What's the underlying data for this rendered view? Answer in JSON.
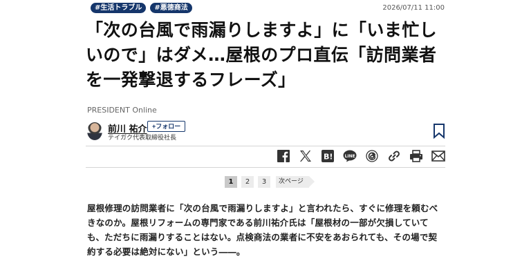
{
  "tags": [
    "#生活トラブル",
    "#悪徳商法"
  ],
  "date": "2026/07/11 11:00",
  "headline": "「次の台風で雨漏りしますよ」に「いま忙しいので」はダメ…屋根のプロ直伝「訪問業者を一発撃退するフレーズ」",
  "source": "PRESIDENT Online",
  "author": {
    "name": "前川 祐介",
    "follow_label": "+フォロー",
    "title": "テイガク代表取締役社長"
  },
  "share_icons": [
    "facebook-icon",
    "x-icon",
    "hatena-bookmark-icon",
    "line-icon",
    "threads-icon",
    "link-icon",
    "print-icon",
    "mail-icon"
  ],
  "pagination": {
    "pages": [
      "1",
      "2",
      "3"
    ],
    "current": "1",
    "next_label": "次ページ"
  },
  "lead": "屋根修理の訪問業者に「次の台風で雨漏りしますよ」と言われたら、すぐに修理を頼むべきなのか。屋根リフォームの専門家である前川祐介氏は「屋根材の一部が欠損していても、ただちに雨漏りすることはない。点検商法の業者に不安をあおられても、その場で契約する必要は絶対にない」という――。",
  "colors": {
    "accent": "#15366b",
    "rule": "#d4d4d4"
  }
}
